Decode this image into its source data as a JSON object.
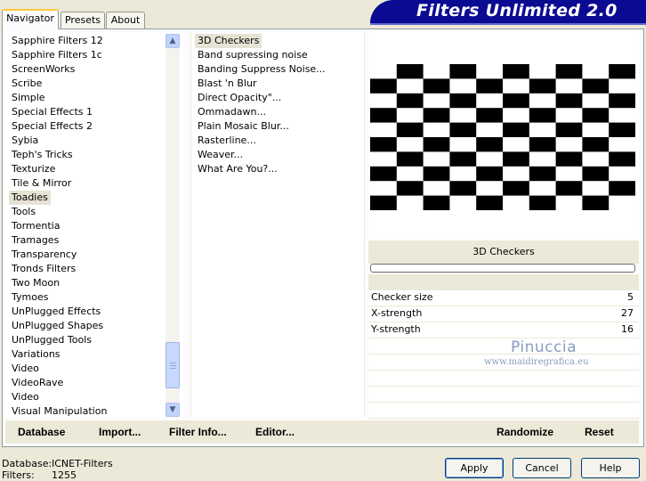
{
  "tabs": [
    "Navigator",
    "Presets",
    "About"
  ],
  "banner_title": "Filters Unlimited 2.0",
  "categories": [
    "Sapphire Filters 12",
    "Sapphire Filters 1c",
    "ScreenWorks",
    "Scribe",
    "Simple",
    "Special Effects 1",
    "Special Effects 2",
    "Sybia",
    "Teph's Tricks",
    "Texturize",
    "Tile & Mirror",
    "Toadies",
    "Tools",
    "Tormentia",
    "Tramages",
    "Transparency",
    "Tronds Filters",
    "Two Moon",
    "Tymoes",
    "UnPlugged Effects",
    "UnPlugged Shapes",
    "UnPlugged Tools",
    "Variations",
    "Video",
    "VideoRave",
    "Video",
    "Visual Manipulation"
  ],
  "selected_category": "Toadies",
  "filters": [
    "3D Checkers",
    "Band supressing noise",
    "Banding Suppress Noise...",
    "Blast 'n Blur",
    "Direct Opacity\"...",
    "Ommadawn...",
    "Plain Mosaic Blur...",
    "Rasterline...",
    "Weaver...",
    "What Are You?..."
  ],
  "selected_filter": "3D Checkers",
  "preview_name": "3D Checkers",
  "params": [
    {
      "label": "Checker size",
      "value": "5"
    },
    {
      "label": "X-strength",
      "value": "27"
    },
    {
      "label": "Y-strength",
      "value": "16"
    }
  ],
  "watermark": {
    "name": "Pinuccia",
    "url": "www.maidiregrafica.eu"
  },
  "commands": {
    "database": "Database",
    "import": "Import...",
    "filter_info": "Filter Info...",
    "editor": "Editor...",
    "randomize": "Randomize",
    "reset": "Reset"
  },
  "status": {
    "database_label": "Database:",
    "database_value": "ICNET-Filters",
    "filters_label": "Filters:",
    "filters_value": "1255"
  },
  "buttons": {
    "apply": "Apply",
    "cancel": "Cancel",
    "help": "Help"
  },
  "scroll_position": 0.86
}
